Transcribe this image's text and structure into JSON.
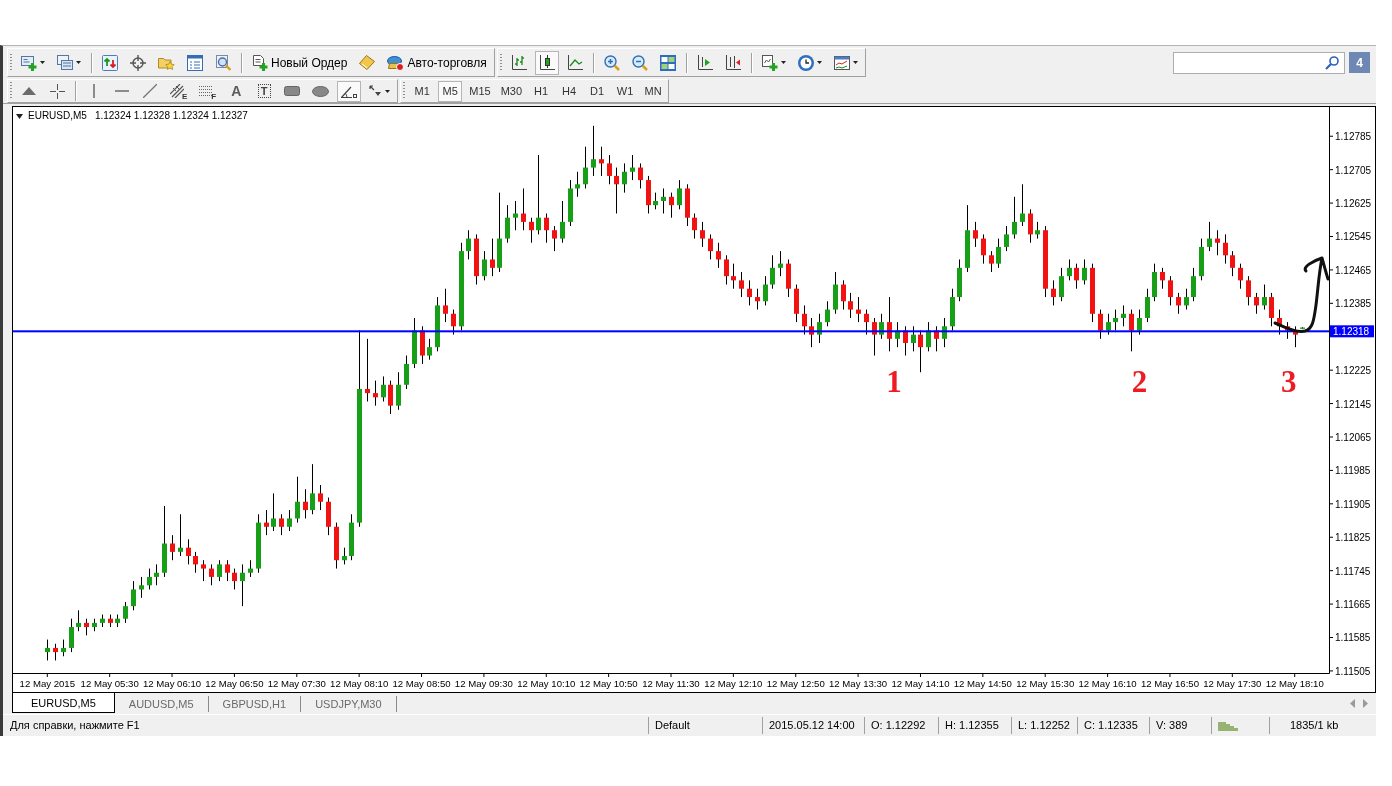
{
  "main_toolbar": [
    [
      {
        "kind": "new-chart",
        "dropdown": true
      },
      {
        "kind": "profiles",
        "dropdown": true
      }
    ],
    [
      {
        "kind": "market-watch"
      },
      {
        "kind": "data-window"
      },
      {
        "kind": "navigator"
      },
      {
        "kind": "terminal"
      },
      {
        "kind": "tester"
      }
    ],
    [
      {
        "kind": "new-order",
        "label": "Новый Ордер"
      },
      {
        "kind": "editor"
      },
      {
        "kind": "autotrading",
        "label": "Авто-торговля"
      }
    ]
  ],
  "chart_toolbar": {
    "chart_types": [
      {
        "kind": "bars",
        "selected": false
      },
      {
        "kind": "candles",
        "selected": true
      },
      {
        "kind": "line",
        "selected": false
      }
    ],
    "groups": [
      [
        {
          "kind": "zoom-in"
        },
        {
          "kind": "zoom-out"
        },
        {
          "kind": "tile"
        }
      ],
      [
        {
          "kind": "chart-shift"
        },
        {
          "kind": "autoscroll"
        }
      ],
      [
        {
          "kind": "indicators",
          "dropdown": true
        },
        {
          "kind": "periods",
          "dropdown": true
        },
        {
          "kind": "templates",
          "dropdown": true
        }
      ]
    ]
  },
  "notifications": {
    "count": "4"
  },
  "drawing_tools": [
    [
      {
        "kind": "cursor",
        "selected": false
      },
      {
        "kind": "crosshair",
        "selected": false
      }
    ],
    [
      {
        "kind": "vertical-line",
        "selected": false
      },
      {
        "kind": "horizontal-line",
        "selected": false
      },
      {
        "kind": "trend-line",
        "selected": false
      },
      {
        "kind": "channel",
        "label": "E",
        "selected": false
      },
      {
        "kind": "fibonacci",
        "label": "F",
        "selected": false
      },
      {
        "kind": "text",
        "label": "A",
        "selected": false
      },
      {
        "kind": "text-label",
        "label": "T",
        "selected": false
      },
      {
        "kind": "rectangle",
        "selected": false
      },
      {
        "kind": "ellipse",
        "selected": false
      },
      {
        "kind": "angle",
        "selected": true
      },
      {
        "kind": "arrows",
        "selected": false,
        "dropdown": true
      }
    ]
  ],
  "timeframes": [
    {
      "label": "M1",
      "selected": false
    },
    {
      "label": "M5",
      "selected": true
    },
    {
      "label": "M15",
      "selected": false
    },
    {
      "label": "M30",
      "selected": false
    },
    {
      "label": "H1",
      "selected": false
    },
    {
      "label": "H4",
      "selected": false
    },
    {
      "label": "D1",
      "selected": false
    },
    {
      "label": "W1",
      "selected": false
    },
    {
      "label": "MN",
      "selected": false
    }
  ],
  "chart": {
    "chart_data": [
      {
        "type": "candlestick",
        "title": "EURUSD,M5",
        "subtitle": "1.12324 1.12328 1.12324 1.12327",
        "x": [
          "2015-05-12T04:50",
          "2015-05-12T04:55",
          "2015-05-12T05:00",
          "2015-05-12T05:05",
          "2015-05-12T05:10",
          "2015-05-12T05:15",
          "2015-05-12T05:20",
          "2015-05-12T05:25",
          "2015-05-12T05:30",
          "2015-05-12T05:35",
          "2015-05-12T05:40",
          "2015-05-12T05:45",
          "2015-05-12T05:50",
          "2015-05-12T05:55",
          "2015-05-12T06:00",
          "2015-05-12T06:05",
          "2015-05-12T06:10",
          "2015-05-12T06:15",
          "2015-05-12T06:20",
          "2015-05-12T06:25",
          "2015-05-12T06:30",
          "2015-05-12T06:35",
          "2015-05-12T06:40",
          "2015-05-12T06:45",
          "2015-05-12T06:50",
          "2015-05-12T06:55",
          "2015-05-12T07:00",
          "2015-05-12T07:05",
          "2015-05-12T07:10",
          "2015-05-12T07:15",
          "2015-05-12T07:20",
          "2015-05-12T07:25",
          "2015-05-12T07:30",
          "2015-05-12T07:35",
          "2015-05-12T07:40",
          "2015-05-12T07:45",
          "2015-05-12T07:50",
          "2015-05-12T07:55",
          "2015-05-12T08:00",
          "2015-05-12T08:05",
          "2015-05-12T08:10",
          "2015-05-12T08:15",
          "2015-05-12T08:20",
          "2015-05-12T08:25",
          "2015-05-12T08:30",
          "2015-05-12T08:35",
          "2015-05-12T08:40",
          "2015-05-12T08:45",
          "2015-05-12T08:50",
          "2015-05-12T08:55",
          "2015-05-12T09:00",
          "2015-05-12T09:05",
          "2015-05-12T09:10",
          "2015-05-12T09:15",
          "2015-05-12T09:20",
          "2015-05-12T09:25",
          "2015-05-12T09:30",
          "2015-05-12T09:35",
          "2015-05-12T09:40",
          "2015-05-12T09:45",
          "2015-05-12T09:50",
          "2015-05-12T09:55",
          "2015-05-12T10:00",
          "2015-05-12T10:05",
          "2015-05-12T10:10",
          "2015-05-12T10:15",
          "2015-05-12T10:20",
          "2015-05-12T10:25",
          "2015-05-12T10:30",
          "2015-05-12T10:35",
          "2015-05-12T10:40",
          "2015-05-12T10:45",
          "2015-05-12T10:50",
          "2015-05-12T10:55",
          "2015-05-12T11:00",
          "2015-05-12T11:05",
          "2015-05-12T11:10",
          "2015-05-12T11:15",
          "2015-05-12T11:20",
          "2015-05-12T11:25",
          "2015-05-12T11:30",
          "2015-05-12T11:35",
          "2015-05-12T11:40",
          "2015-05-12T11:45",
          "2015-05-12T11:50",
          "2015-05-12T11:55",
          "2015-05-12T12:00",
          "2015-05-12T12:05",
          "2015-05-12T12:10",
          "2015-05-12T12:15",
          "2015-05-12T12:20",
          "2015-05-12T12:25",
          "2015-05-12T12:30",
          "2015-05-12T12:35",
          "2015-05-12T12:40",
          "2015-05-12T12:45",
          "2015-05-12T12:50",
          "2015-05-12T12:55",
          "2015-05-12T13:00",
          "2015-05-12T13:05",
          "2015-05-12T13:10",
          "2015-05-12T13:15",
          "2015-05-12T13:20",
          "2015-05-12T13:25",
          "2015-05-12T13:30",
          "2015-05-12T13:35",
          "2015-05-12T13:40",
          "2015-05-12T13:45",
          "2015-05-12T13:50",
          "2015-05-12T13:55",
          "2015-05-12T14:00",
          "2015-05-12T14:05",
          "2015-05-12T14:10",
          "2015-05-12T14:15",
          "2015-05-12T14:20",
          "2015-05-12T14:25",
          "2015-05-12T14:30",
          "2015-05-12T14:35",
          "2015-05-12T14:40",
          "2015-05-12T14:45",
          "2015-05-12T14:50",
          "2015-05-12T14:55",
          "2015-05-12T15:00",
          "2015-05-12T15:05",
          "2015-05-12T15:10",
          "2015-05-12T15:15",
          "2015-05-12T15:20",
          "2015-05-12T15:25",
          "2015-05-12T15:30",
          "2015-05-12T15:35",
          "2015-05-12T15:40",
          "2015-05-12T15:45",
          "2015-05-12T15:50",
          "2015-05-12T15:55",
          "2015-05-12T16:00",
          "2015-05-12T16:05",
          "2015-05-12T16:10",
          "2015-05-12T16:15",
          "2015-05-12T16:20",
          "2015-05-12T16:25",
          "2015-05-12T16:30",
          "2015-05-12T16:35",
          "2015-05-12T16:40",
          "2015-05-12T16:45",
          "2015-05-12T16:50",
          "2015-05-12T16:55",
          "2015-05-12T17:00",
          "2015-05-12T17:05",
          "2015-05-12T17:10",
          "2015-05-12T17:15",
          "2015-05-12T17:20",
          "2015-05-12T17:25",
          "2015-05-12T17:30",
          "2015-05-12T17:35",
          "2015-05-12T17:40",
          "2015-05-12T17:45",
          "2015-05-12T17:50",
          "2015-05-12T17:55",
          "2015-05-12T18:00",
          "2015-05-12T18:05",
          "2015-05-12T18:10",
          "2015-05-12T18:15"
        ],
        "ohlc": [
          [
            1.1155,
            1.1158,
            1.1153,
            1.1156
          ],
          [
            1.1156,
            1.1157,
            1.1153,
            1.1155
          ],
          [
            1.1155,
            1.1158,
            1.1154,
            1.1156
          ],
          [
            1.1156,
            1.1163,
            1.1155,
            1.1161
          ],
          [
            1.1161,
            1.1165,
            1.116,
            1.1162
          ],
          [
            1.1162,
            1.1163,
            1.1159,
            1.1161
          ],
          [
            1.1161,
            1.1163,
            1.116,
            1.1162
          ],
          [
            1.1162,
            1.1164,
            1.1161,
            1.1163
          ],
          [
            1.1163,
            1.1164,
            1.1161,
            1.1162
          ],
          [
            1.1162,
            1.1164,
            1.1161,
            1.1163
          ],
          [
            1.1163,
            1.1167,
            1.1162,
            1.1166
          ],
          [
            1.1166,
            1.1172,
            1.1165,
            1.117
          ],
          [
            1.117,
            1.1173,
            1.1168,
            1.1171
          ],
          [
            1.1171,
            1.1175,
            1.117,
            1.1173
          ],
          [
            1.1173,
            1.1176,
            1.1171,
            1.1174
          ],
          [
            1.1174,
            1.119,
            1.1173,
            1.1181
          ],
          [
            1.1181,
            1.1183,
            1.1177,
            1.1179
          ],
          [
            1.1179,
            1.1188,
            1.1178,
            1.118
          ],
          [
            1.118,
            1.1182,
            1.1176,
            1.1178
          ],
          [
            1.1178,
            1.1179,
            1.1174,
            1.1176
          ],
          [
            1.1176,
            1.1177,
            1.1172,
            1.1175
          ],
          [
            1.1175,
            1.1176,
            1.1171,
            1.1173
          ],
          [
            1.1173,
            1.1177,
            1.1172,
            1.1176
          ],
          [
            1.1176,
            1.1177,
            1.1172,
            1.1174
          ],
          [
            1.1174,
            1.1175,
            1.117,
            1.1172
          ],
          [
            1.1172,
            1.1176,
            1.1166,
            1.1174
          ],
          [
            1.1174,
            1.1177,
            1.1173,
            1.1175
          ],
          [
            1.1175,
            1.1188,
            1.1174,
            1.1186
          ],
          [
            1.1186,
            1.1189,
            1.1183,
            1.1185
          ],
          [
            1.1185,
            1.1193,
            1.1184,
            1.1187
          ],
          [
            1.1187,
            1.1188,
            1.1183,
            1.1185
          ],
          [
            1.1185,
            1.1189,
            1.1184,
            1.1187
          ],
          [
            1.1187,
            1.1197,
            1.1186,
            1.1191
          ],
          [
            1.1191,
            1.1194,
            1.1187,
            1.1189
          ],
          [
            1.1189,
            1.12,
            1.1188,
            1.1193
          ],
          [
            1.1193,
            1.1195,
            1.1189,
            1.1191
          ],
          [
            1.1191,
            1.1192,
            1.1183,
            1.1185
          ],
          [
            1.1185,
            1.1186,
            1.1175,
            1.1177
          ],
          [
            1.1177,
            1.118,
            1.1176,
            1.1178
          ],
          [
            1.1178,
            1.1188,
            1.1177,
            1.1186
          ],
          [
            1.1186,
            1.1232,
            1.1185,
            1.1218
          ],
          [
            1.1218,
            1.123,
            1.1215,
            1.1217
          ],
          [
            1.1217,
            1.122,
            1.1214,
            1.1216
          ],
          [
            1.1216,
            1.1221,
            1.1215,
            1.1219
          ],
          [
            1.1219,
            1.122,
            1.1212,
            1.1214
          ],
          [
            1.1214,
            1.1222,
            1.1213,
            1.1219
          ],
          [
            1.1219,
            1.1226,
            1.1218,
            1.1224
          ],
          [
            1.1224,
            1.1235,
            1.1223,
            1.1232
          ],
          [
            1.1232,
            1.1233,
            1.1224,
            1.1226
          ],
          [
            1.1226,
            1.123,
            1.1225,
            1.1228
          ],
          [
            1.1228,
            1.124,
            1.1227,
            1.1238
          ],
          [
            1.1238,
            1.1242,
            1.1234,
            1.1236
          ],
          [
            1.1236,
            1.1237,
            1.1231,
            1.1233
          ],
          [
            1.1233,
            1.1253,
            1.1232,
            1.1251
          ],
          [
            1.1251,
            1.1256,
            1.1249,
            1.1254
          ],
          [
            1.1254,
            1.1255,
            1.1243,
            1.1245
          ],
          [
            1.1245,
            1.1251,
            1.1244,
            1.1249
          ],
          [
            1.1249,
            1.1254,
            1.1245,
            1.1247
          ],
          [
            1.1247,
            1.1265,
            1.1246,
            1.1254
          ],
          [
            1.1254,
            1.1262,
            1.1253,
            1.1259
          ],
          [
            1.1259,
            1.1263,
            1.1256,
            1.126
          ],
          [
            1.126,
            1.1266,
            1.1256,
            1.1258
          ],
          [
            1.1258,
            1.1259,
            1.1253,
            1.1256
          ],
          [
            1.1256,
            1.1274,
            1.1255,
            1.1259
          ],
          [
            1.1259,
            1.126,
            1.1253,
            1.1256
          ],
          [
            1.1256,
            1.1257,
            1.1251,
            1.1254
          ],
          [
            1.1254,
            1.1263,
            1.1253,
            1.1258
          ],
          [
            1.1258,
            1.1268,
            1.1257,
            1.1266
          ],
          [
            1.1266,
            1.127,
            1.1264,
            1.1267
          ],
          [
            1.1267,
            1.1276,
            1.1266,
            1.1271
          ],
          [
            1.1271,
            1.1281,
            1.1269,
            1.1273
          ],
          [
            1.1273,
            1.1276,
            1.1269,
            1.1272
          ],
          [
            1.1272,
            1.1274,
            1.1267,
            1.1269
          ],
          [
            1.1269,
            1.1271,
            1.126,
            1.1267
          ],
          [
            1.1267,
            1.1272,
            1.1265,
            1.127
          ],
          [
            1.127,
            1.1274,
            1.1268,
            1.1271
          ],
          [
            1.1271,
            1.1272,
            1.1266,
            1.1268
          ],
          [
            1.1268,
            1.1269,
            1.126,
            1.1262
          ],
          [
            1.1262,
            1.1265,
            1.1261,
            1.1263
          ],
          [
            1.1263,
            1.1266,
            1.126,
            1.1264
          ],
          [
            1.1264,
            1.1265,
            1.1259,
            1.1262
          ],
          [
            1.1262,
            1.1268,
            1.1261,
            1.1266
          ],
          [
            1.1266,
            1.1267,
            1.1257,
            1.1259
          ],
          [
            1.1259,
            1.126,
            1.1254,
            1.1256
          ],
          [
            1.1256,
            1.1258,
            1.1252,
            1.1254
          ],
          [
            1.1254,
            1.1255,
            1.1249,
            1.1251
          ],
          [
            1.1251,
            1.1253,
            1.1247,
            1.1249
          ],
          [
            1.1249,
            1.125,
            1.1243,
            1.1245
          ],
          [
            1.1245,
            1.1248,
            1.1242,
            1.1244
          ],
          [
            1.1244,
            1.1246,
            1.124,
            1.1242
          ],
          [
            1.1242,
            1.1244,
            1.1238,
            1.124
          ],
          [
            1.124,
            1.1242,
            1.1237,
            1.1239
          ],
          [
            1.1239,
            1.1245,
            1.1238,
            1.1243
          ],
          [
            1.1243,
            1.125,
            1.1242,
            1.1247
          ],
          [
            1.1247,
            1.1251,
            1.1245,
            1.1248
          ],
          [
            1.1248,
            1.1249,
            1.124,
            1.1242
          ],
          [
            1.1242,
            1.1243,
            1.1234,
            1.1236
          ],
          [
            1.1236,
            1.1238,
            1.1231,
            1.1233
          ],
          [
            1.1233,
            1.1235,
            1.1228,
            1.1231
          ],
          [
            1.1231,
            1.1236,
            1.1229,
            1.1234
          ],
          [
            1.1234,
            1.1239,
            1.1233,
            1.1237
          ],
          [
            1.1237,
            1.1246,
            1.1236,
            1.1243
          ],
          [
            1.1243,
            1.1244,
            1.1237,
            1.1239
          ],
          [
            1.1239,
            1.1241,
            1.1235,
            1.1237
          ],
          [
            1.1237,
            1.124,
            1.1234,
            1.1236
          ],
          [
            1.1236,
            1.1237,
            1.1231,
            1.1234
          ],
          [
            1.1234,
            1.1235,
            1.1226,
            1.1231
          ],
          [
            1.1231,
            1.1236,
            1.123,
            1.1234
          ],
          [
            1.1234,
            1.124,
            1.1227,
            1.123
          ],
          [
            1.123,
            1.1234,
            1.1228,
            1.1232
          ],
          [
            1.1232,
            1.1233,
            1.1226,
            1.1229
          ],
          [
            1.1229,
            1.1233,
            1.1227,
            1.1231
          ],
          [
            1.1231,
            1.1232,
            1.1222,
            1.1228
          ],
          [
            1.1228,
            1.1234,
            1.1227,
            1.1232
          ],
          [
            1.1232,
            1.1233,
            1.1227,
            1.123
          ],
          [
            1.123,
            1.1235,
            1.1228,
            1.1233
          ],
          [
            1.1233,
            1.1242,
            1.1232,
            1.124
          ],
          [
            1.124,
            1.1249,
            1.1239,
            1.1247
          ],
          [
            1.1247,
            1.1262,
            1.1246,
            1.1256
          ],
          [
            1.1256,
            1.1258,
            1.1252,
            1.1254
          ],
          [
            1.1254,
            1.1255,
            1.1248,
            1.125
          ],
          [
            1.125,
            1.1251,
            1.1246,
            1.1248
          ],
          [
            1.1248,
            1.1254,
            1.1247,
            1.1252
          ],
          [
            1.1252,
            1.1257,
            1.1251,
            1.1255
          ],
          [
            1.1255,
            1.1264,
            1.1254,
            1.1258
          ],
          [
            1.1258,
            1.1267,
            1.1257,
            1.126
          ],
          [
            1.126,
            1.1261,
            1.1253,
            1.1255
          ],
          [
            1.1255,
            1.1258,
            1.1254,
            1.1256
          ],
          [
            1.1256,
            1.1257,
            1.124,
            1.1242
          ],
          [
            1.1242,
            1.1244,
            1.1238,
            1.124
          ],
          [
            1.124,
            1.1247,
            1.1239,
            1.1245
          ],
          [
            1.1245,
            1.1249,
            1.1244,
            1.1247
          ],
          [
            1.1247,
            1.1248,
            1.1242,
            1.1244
          ],
          [
            1.1244,
            1.1249,
            1.1243,
            1.1247
          ],
          [
            1.1247,
            1.1248,
            1.1234,
            1.1236
          ],
          [
            1.1236,
            1.1237,
            1.123,
            1.1232
          ],
          [
            1.1232,
            1.1236,
            1.1231,
            1.1234
          ],
          [
            1.1234,
            1.1237,
            1.1232,
            1.1235
          ],
          [
            1.1235,
            1.1238,
            1.1233,
            1.1236
          ],
          [
            1.1236,
            1.1237,
            1.1227,
            1.1232
          ],
          [
            1.1232,
            1.1237,
            1.1231,
            1.1235
          ],
          [
            1.1235,
            1.1242,
            1.1234,
            1.124
          ],
          [
            1.124,
            1.1248,
            1.1239,
            1.1246
          ],
          [
            1.1246,
            1.1247,
            1.1242,
            1.1244
          ],
          [
            1.1244,
            1.1245,
            1.1238,
            1.124
          ],
          [
            1.124,
            1.1241,
            1.1236,
            1.1238
          ],
          [
            1.1238,
            1.1242,
            1.1237,
            1.124
          ],
          [
            1.124,
            1.1247,
            1.1239,
            1.1245
          ],
          [
            1.1245,
            1.1254,
            1.1244,
            1.1252
          ],
          [
            1.1252,
            1.1258,
            1.1251,
            1.1254
          ],
          [
            1.1254,
            1.1256,
            1.125,
            1.1253
          ],
          [
            1.1253,
            1.1255,
            1.1248,
            1.125
          ],
          [
            1.125,
            1.1251,
            1.1245,
            1.1247
          ],
          [
            1.1247,
            1.1248,
            1.1242,
            1.1244
          ],
          [
            1.1244,
            1.1245,
            1.1238,
            1.124
          ],
          [
            1.124,
            1.1241,
            1.1236,
            1.1238
          ],
          [
            1.1238,
            1.1243,
            1.1237,
            1.124
          ],
          [
            1.124,
            1.1241,
            1.1233,
            1.1235
          ],
          [
            1.1235,
            1.1237,
            1.1231,
            1.1233
          ],
          [
            1.1233,
            1.1234,
            1.123,
            1.1232
          ],
          [
            1.1232,
            1.1233,
            1.1228,
            1.1231
          ],
          [
            1.12324,
            1.12328,
            1.12324,
            1.12327
          ]
        ],
        "xlim": [
          "2015-05-12T04:28",
          "2015-05-12T18:32"
        ],
        "ylim": [
          1.115,
          1.12855
        ],
        "yticks": [
          1.12785,
          1.12705,
          1.12625,
          1.12545,
          1.12465,
          1.12385,
          1.12225,
          1.12145,
          1.12065,
          1.11985,
          1.11905,
          1.11825,
          1.11745,
          1.11665,
          1.11585,
          1.11505
        ],
        "xticks": [
          {
            "value": "2015-05-12T04:50",
            "label": "12 May 2015"
          },
          {
            "value": "2015-05-12T05:30",
            "label": "12 May 05:30"
          },
          {
            "value": "2015-05-12T06:10",
            "label": "12 May 06:10"
          },
          {
            "value": "2015-05-12T06:50",
            "label": "12 May 06:50"
          },
          {
            "value": "2015-05-12T07:30",
            "label": "12 May 07:30"
          },
          {
            "value": "2015-05-12T08:10",
            "label": "12 May 08:10"
          },
          {
            "value": "2015-05-12T08:50",
            "label": "12 May 08:50"
          },
          {
            "value": "2015-05-12T09:30",
            "label": "12 May 09:30"
          },
          {
            "value": "2015-05-12T10:10",
            "label": "12 May 10:10"
          },
          {
            "value": "2015-05-12T10:50",
            "label": "12 May 10:50"
          },
          {
            "value": "2015-05-12T11:30",
            "label": "12 May 11:30"
          },
          {
            "value": "2015-05-12T12:10",
            "label": "12 May 12:10"
          },
          {
            "value": "2015-05-12T12:50",
            "label": "12 May 12:50"
          },
          {
            "value": "2015-05-12T13:30",
            "label": "12 May 13:30"
          },
          {
            "value": "2015-05-12T14:10",
            "label": "12 May 14:10"
          },
          {
            "value": "2015-05-12T14:50",
            "label": "12 May 14:50"
          },
          {
            "value": "2015-05-12T15:30",
            "label": "12 May 15:30"
          },
          {
            "value": "2015-05-12T16:10",
            "label": "12 May 16:10"
          },
          {
            "value": "2015-05-12T16:50",
            "label": "12 May 16:50"
          },
          {
            "value": "2015-05-12T17:30",
            "label": "12 May 17:30"
          },
          {
            "value": "2015-05-12T18:10",
            "label": "12 May 18:10"
          }
        ],
        "ref_lines": [
          {
            "axis": "y",
            "value": 1.12318,
            "label": "1.12318",
            "color": "#0000ff"
          }
        ],
        "annotations": [
          "1",
          "2",
          "3"
        ]
      }
    ]
  },
  "chart_tabs": [
    {
      "label": "EURUSD,M5",
      "selected": true
    },
    {
      "label": "AUDUSD,M5",
      "selected": false
    },
    {
      "label": "GBPUSD,H1",
      "selected": false
    },
    {
      "label": "USDJPY,M30",
      "selected": false
    }
  ],
  "status_bar": {
    "help": "Для справки, нажмите F1",
    "profile": "Default",
    "time": "2015.05.12 14:00",
    "open": "O: 1.12292",
    "high": "H: 1.12355",
    "low": "L: 1.12252",
    "close": "C: 1.12335",
    "volume": "V: 389",
    "traffic": "1835/1 kb"
  }
}
